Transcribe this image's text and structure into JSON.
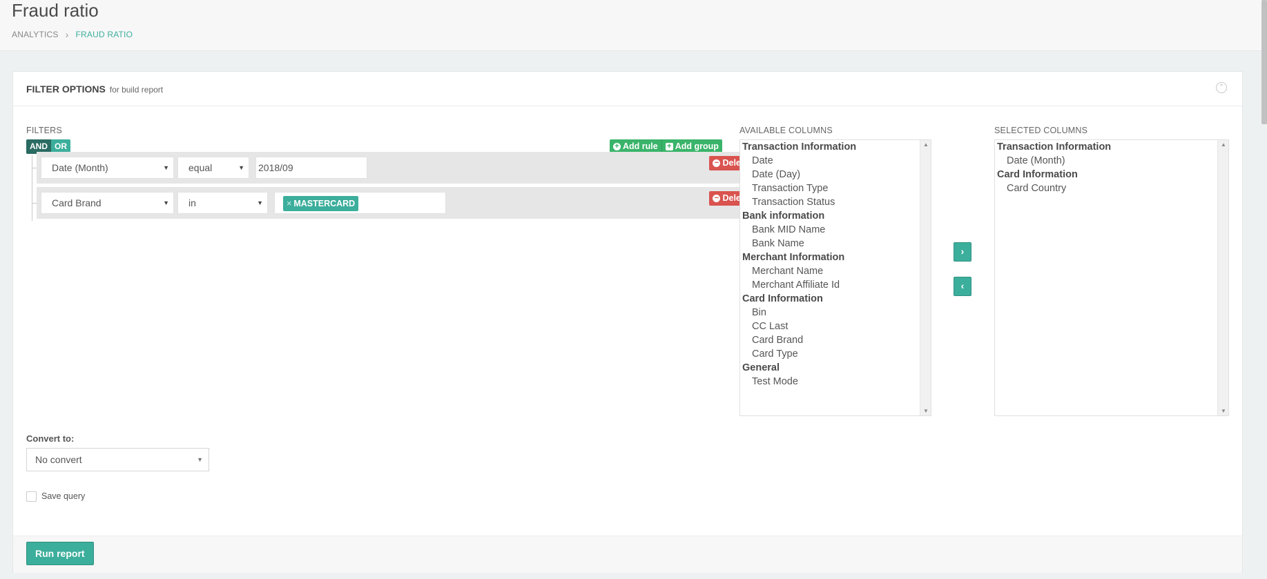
{
  "header": {
    "title": "Fraud ratio",
    "breadcrumb": [
      "ANALYTICS",
      "FRAUD RATIO"
    ],
    "breadcrumb_sep": "›"
  },
  "panel": {
    "title": "FILTER OPTIONS",
    "subtitle": "for build report",
    "collapse_icon": "⌃"
  },
  "filters": {
    "label": "FILTERS",
    "and_label": "AND",
    "or_label": "OR",
    "add_rule_label": "Add rule",
    "add_group_label": "Add group",
    "delete_label": "Delete",
    "rules": [
      {
        "field": "Date (Month)",
        "operator": "equal",
        "value": "2018/09"
      },
      {
        "field": "Card Brand",
        "operator": "in",
        "tag": "MASTERCARD"
      }
    ]
  },
  "available": {
    "label": "AVAILABLE COLUMNS",
    "groups": [
      {
        "name": "Transaction Information",
        "options": [
          "Date",
          "Date (Day)",
          "Transaction Type",
          "Transaction Status"
        ]
      },
      {
        "name": "Bank information",
        "options": [
          "Bank MID Name",
          "Bank Name"
        ]
      },
      {
        "name": "Merchant Information",
        "options": [
          "Merchant Name",
          "Merchant Affiliate Id"
        ]
      },
      {
        "name": "Card Information",
        "options": [
          "Bin",
          "CC Last",
          "Card Brand",
          "Card Type"
        ]
      },
      {
        "name": "General",
        "options": [
          "Test Mode"
        ]
      }
    ]
  },
  "selected": {
    "label": "SELECTED COLUMNS",
    "groups": [
      {
        "name": "Transaction Information",
        "options": [
          "Date (Month)"
        ]
      },
      {
        "name": "Card Information",
        "options": [
          "Card Country"
        ]
      }
    ]
  },
  "move": {
    "right": "›",
    "left": "‹"
  },
  "convert": {
    "label": "Convert to:",
    "value": "No convert"
  },
  "save_query_label": "Save query",
  "run_report_label": "Run report",
  "colors": {
    "accent": "#3cae9c",
    "green": "#3ab46a",
    "danger": "#d9534f",
    "dark_accent": "#2a6b62"
  }
}
